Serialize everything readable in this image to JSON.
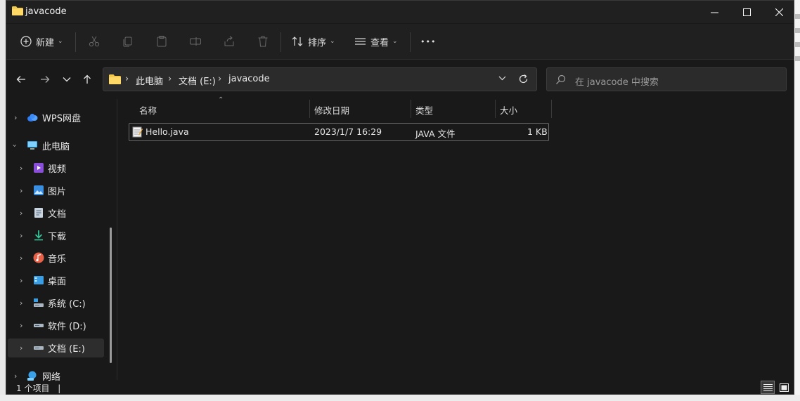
{
  "window": {
    "title": "javacode"
  },
  "toolbar": {
    "new_label": "新建",
    "sort_label": "排序",
    "view_label": "查看",
    "more_label": "•••"
  },
  "address": {
    "crumbs": [
      "此电脑",
      "文档 (E:)",
      "javacode"
    ]
  },
  "search": {
    "placeholder": "在 javacode 中搜索"
  },
  "nav": {
    "items": [
      {
        "label": "WPS网盘"
      },
      {
        "label": "此电脑"
      },
      {
        "label": "视频"
      },
      {
        "label": "图片"
      },
      {
        "label": "文档"
      },
      {
        "label": "下载"
      },
      {
        "label": "音乐"
      },
      {
        "label": "桌面"
      },
      {
        "label": "系统 (C:)"
      },
      {
        "label": "软件 (D:)"
      },
      {
        "label": "文档 (E:)"
      },
      {
        "label": "网络"
      }
    ]
  },
  "columns": {
    "name": "名称",
    "modified": "修改日期",
    "type": "类型",
    "size": "大小"
  },
  "files": [
    {
      "name": "Hello.java",
      "modified": "2023/1/7 16:29",
      "type": "JAVA 文件",
      "size": "1 KB"
    }
  ],
  "status": {
    "count_text": "1 个项目",
    "separator": "|"
  },
  "colors": {
    "background": "#191919",
    "accent_folder": "#f2c94c"
  }
}
